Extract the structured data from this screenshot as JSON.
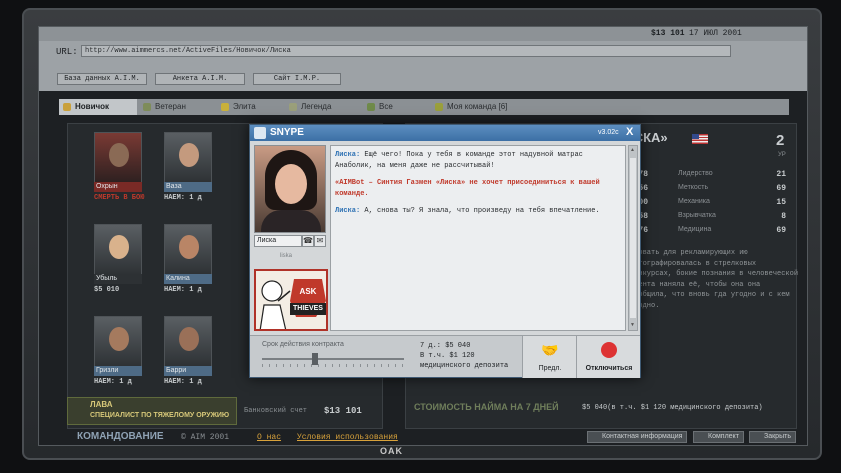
{
  "browser": {
    "balance": "$13 101",
    "date": "17 ИЮЛ 2001",
    "url_label": "URL:",
    "url": "http://www.aimmercs.net/ActiveFiles/Новичок/Лиска",
    "nav": [
      "База данных A.I.M.",
      "Анкета A.I.M.",
      "Сайт I.M.P."
    ]
  },
  "tabs": [
    {
      "label": "Новичок",
      "active": true
    },
    {
      "label": "Ветеран",
      "active": false
    },
    {
      "label": "Элита",
      "active": false
    },
    {
      "label": "Легенда",
      "active": false
    },
    {
      "label": "Все",
      "active": false
    },
    {
      "label": "Моя команда [6]",
      "active": false
    }
  ],
  "mercs": [
    {
      "name": "",
      "status": "Охрын",
      "fee": "СМЕРТЬ В БОЮ"
    },
    {
      "name": "Ваза",
      "fee": "НАЕМ: 1 д"
    },
    {
      "name": "",
      "status": "Убыль",
      "fee": "$5 010"
    },
    {
      "name": "Калина",
      "fee": "НАЕМ: 1 д"
    },
    {
      "name": "Гризли",
      "fee": "НАЕМ: 1 д"
    },
    {
      "name": "Барри",
      "fee": "НАЕМ: 1 д"
    }
  ],
  "specialist": {
    "name": "ЛАВА",
    "title": "СПЕЦИАЛИСТ ПО ТЯЖЕЛОМУ ОРУЖИЮ"
  },
  "bank": {
    "label": "Банковский счет",
    "value": "$13 101"
  },
  "profile": {
    "title": "«ЛИСКА»",
    "level": "2",
    "level_label": "УР",
    "stats_left": [
      "78",
      "56",
      "100",
      "58",
      "76"
    ],
    "stats_right": [
      {
        "name": "Лидерство",
        "value": "21"
      },
      {
        "name": "Меткость",
        "value": "69"
      },
      {
        "name": "Механика",
        "value": "15"
      },
      {
        "name": "Взрывчатка",
        "value": "8"
      },
      {
        "name": "Медицина",
        "value": "69"
      }
    ],
    "bio": "ировать для рекламирующих ию фотографировалась в стрелковых конкурсах, бокие познания в человеческой идента наняла её, чтобы она она сообщила, что вновь гда угодно и с кем угодно.",
    "hire_cost_label": "СТОИМОСТЬ НАЙМА НА 7 ДНЕЙ",
    "hire_cost_value": "$5 040(в т.ч. $1 120 медицинского депозита)"
  },
  "footer": {
    "command": "КОМАНДОВАНИЕ",
    "copyright": "© AIM 2001",
    "about": "О нас",
    "terms": "Условия использования",
    "buttons": [
      "Контактная информация",
      "Комплект",
      "Закрыть"
    ]
  },
  "dialog": {
    "app_name": "SNYPE",
    "version": "v3.02c",
    "close": "X",
    "contact_name": "Лиска",
    "contact_sub": "liska",
    "ad_top": "ASK",
    "ad_bottom": "THIEVES",
    "messages": [
      {
        "speaker": "Лиска:",
        "text": "Ещё чего! Пока у тебя в команде этот надувной матрас Анаболик, на меня даже не рассчитывай!"
      },
      {
        "speaker": "",
        "text": "«AIMBot – Синтия Газмен «Лиска» не хочет присоединиться к вашей команде."
      },
      {
        "speaker": "Лиска:",
        "text": "А, снова ты? Я знала, что произведу на тебя впечатление."
      }
    ],
    "contract_label": "Срок действия контракта",
    "contract_days": 7,
    "cost_line1": "7 д.: $5 040",
    "cost_line2": "В т.ч.  $1 120",
    "cost_line3": "медицинского депозита",
    "offer_label": "Предл.",
    "hangup_label": "Отключиться"
  },
  "brand": "OAK"
}
